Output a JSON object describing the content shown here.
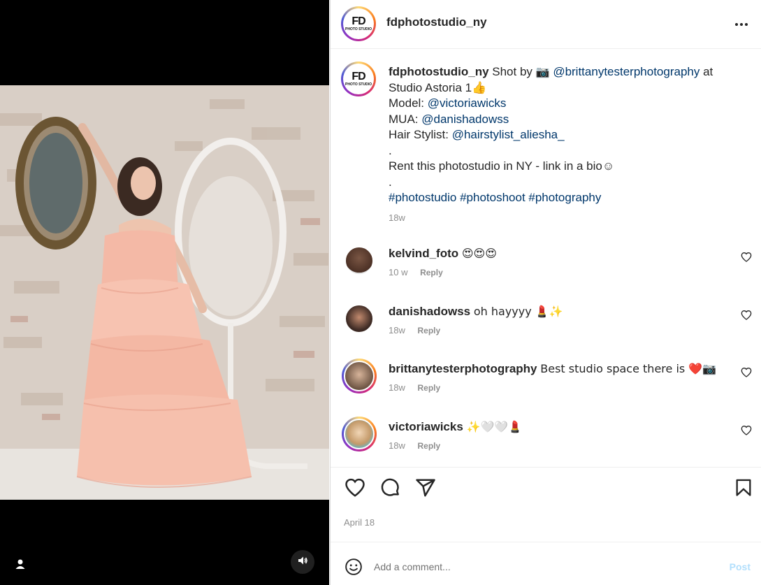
{
  "post": {
    "username": "fdphotostudio_ny",
    "logo_text": "FD",
    "logo_sub": "PHOTO STUDIO",
    "caption": {
      "line1_prefix": "Shot by",
      "line1_emoji": "📷",
      "line1_mention": "@brittanytesterphotography",
      "line1_suffix": "at",
      "line2": "Studio Astoria 1👍",
      "model_label": "Model:",
      "model_mention": "@victoriawicks",
      "mua_label": "MUA:",
      "mua_mention": "@danishadowss",
      "hair_label": "Hair Stylist:",
      "hair_mention": "@hairstylist_aliesha_",
      "dot1": ".",
      "rent_line": "Rent this photostudio in NY - link in a bio☺",
      "dot2": ".",
      "hashtags": "#photostudio #photoshoot #photography",
      "time": "18w"
    },
    "date": "April 18"
  },
  "comments": [
    {
      "username": "kelvind_foto",
      "text": "😍😍😍",
      "time": "10 w",
      "reply": "Reply",
      "avatar_color": "#6b4a3a"
    },
    {
      "username": "danishadowss",
      "text": "oh hayyyy 💄✨",
      "time": "18w",
      "reply": "Reply",
      "avatar_color": "#8a5a4a"
    },
    {
      "username": "brittanytesterphotography",
      "text": "Best studio space there is ❤️📷",
      "time": "18w",
      "reply": "Reply",
      "avatar_color": "#c9a88a"
    },
    {
      "username": "victoriawicks",
      "text": "✨🤍🤍💄",
      "time": "18w",
      "reply": "Reply",
      "avatar_color": "#d8b890"
    }
  ],
  "comment_box": {
    "placeholder": "Add a comment...",
    "post_label": "Post"
  },
  "icons": {
    "more": "more-options-icon",
    "like": "heart-icon",
    "comment": "comment-icon",
    "share": "share-icon",
    "save": "bookmark-icon",
    "emoji": "emoji-icon",
    "sound": "speaker-icon",
    "tag": "user-tag-icon"
  }
}
